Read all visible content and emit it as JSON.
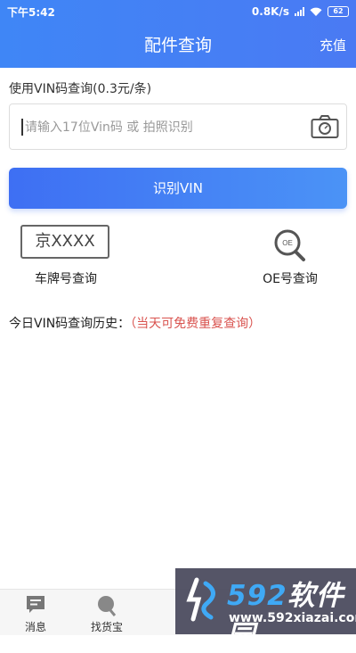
{
  "status_bar": {
    "time": "下午5:42",
    "speed": "0.8K/s",
    "battery": "62"
  },
  "header": {
    "title": "配件查询",
    "recharge": "充值"
  },
  "vin": {
    "hint": "使用VIN码查询(0.3元/条)",
    "placeholder": "请输入17位Vin码 或 拍照识别",
    "button": "识别VIN"
  },
  "plate_query": {
    "sample": "京XXXX",
    "label": "车牌号查询"
  },
  "oe_query": {
    "badge": "OE",
    "label": "OE号查询"
  },
  "history": {
    "label": "今日VIN码查询历史：",
    "note": "（当天可免费重复查询）"
  },
  "tabs": [
    {
      "label": "消息",
      "icon": "message-icon"
    },
    {
      "label": "找货宝",
      "icon": "search-icon"
    }
  ],
  "watermark": {
    "brand_num": "592",
    "brand_text": "软件园",
    "url": "www.592xiazai.com"
  },
  "colors": {
    "primary": "#4a7af3",
    "accent_red": "#d9534f"
  }
}
